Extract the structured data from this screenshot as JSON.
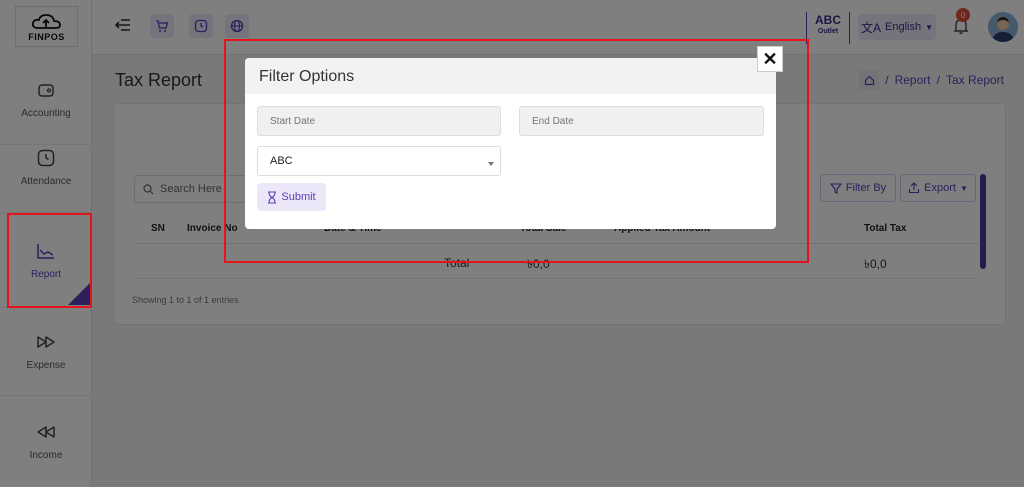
{
  "app": {
    "logo_text": "FINPOS"
  },
  "sidebar": {
    "items": [
      {
        "label": "Accounting",
        "icon": "wallet-icon"
      },
      {
        "label": "Attendance",
        "icon": "clock-icon"
      },
      {
        "label": "Report",
        "icon": "chart-line-icon",
        "active": true
      },
      {
        "label": "Expense",
        "icon": "fast-forward-icon"
      },
      {
        "label": "Income",
        "icon": "rewind-icon"
      }
    ]
  },
  "topbar": {
    "outlet_name": "ABC",
    "outlet_sub": "Outlet",
    "language": "English",
    "notification_count": "0"
  },
  "page": {
    "title": "Tax Report",
    "breadcrumb": [
      "Report",
      "Tax Report"
    ],
    "search_placeholder": "Search Here",
    "filter_label": "Filter By",
    "export_label": "Export",
    "table_headers": [
      "SN",
      "Invoice No",
      "Date & Time",
      "Total Sale",
      "Applied Tax Amount",
      "Total Tax"
    ],
    "total_row": {
      "label": "Total",
      "total_sale": "৳0,0",
      "total_tax": "৳0,0"
    },
    "showing_text": "Showing 1 to 1 of 1 entries"
  },
  "modal": {
    "title": "Filter Options",
    "start_date_placeholder": "Start Date",
    "end_date_placeholder": "End Date",
    "outlet_selected": "ABC",
    "submit_label": "Submit",
    "close_symbol": "✕"
  },
  "colors": {
    "accent": "#5b3fb6",
    "highlight": "#e3141b"
  }
}
